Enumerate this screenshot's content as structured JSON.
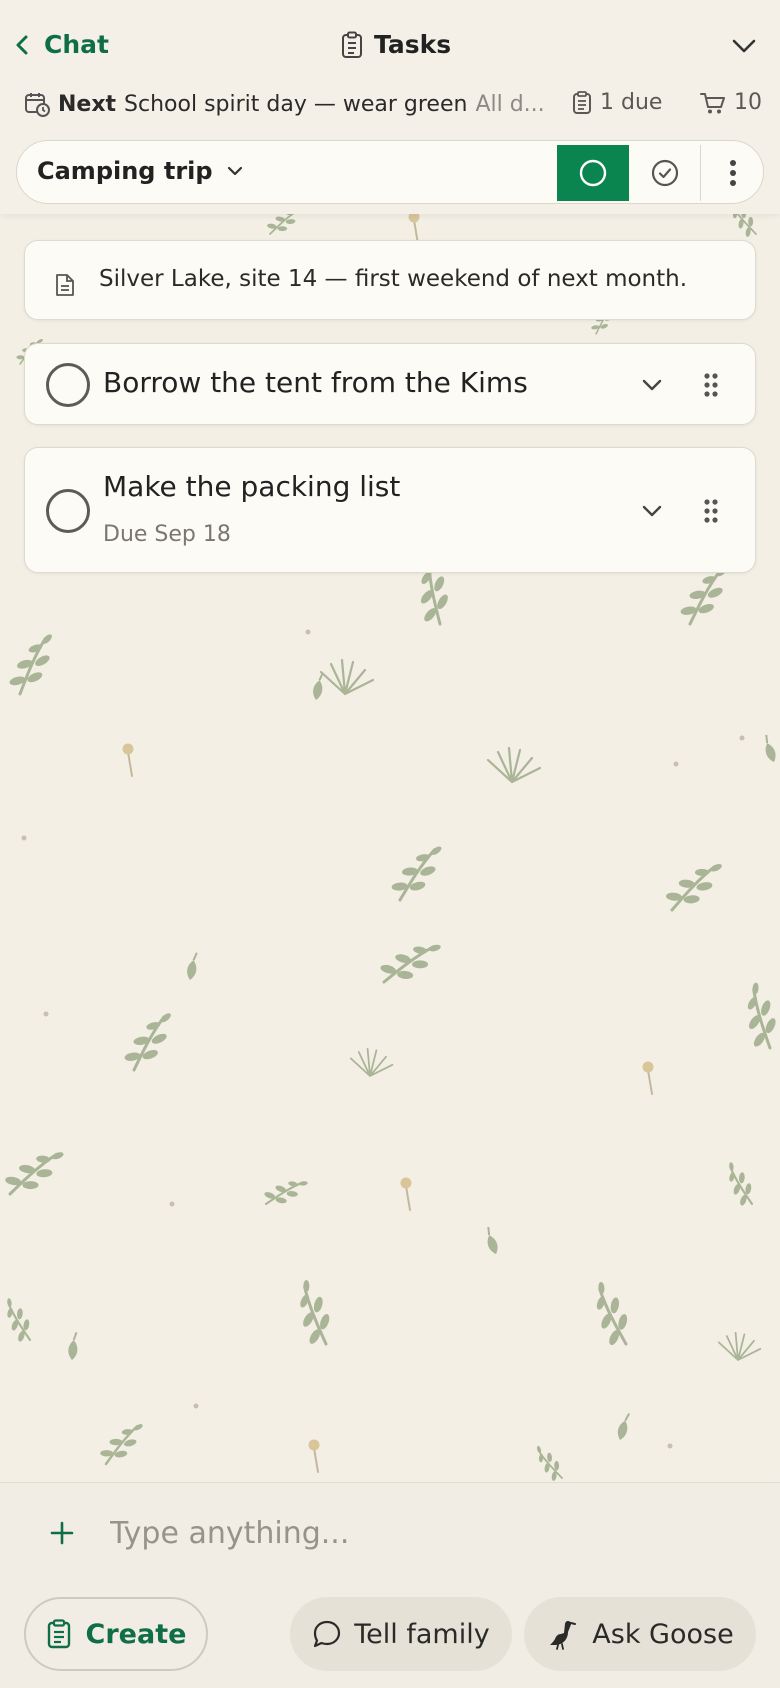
{
  "header": {
    "back_label": "Chat",
    "title": "Tasks",
    "next_label": "Next",
    "next_event": "School spirit day — wear green",
    "next_event_rest": "All d...",
    "due_count": "1 due",
    "cart_count": "10"
  },
  "list": {
    "name": "Camping trip",
    "filter_selected": "open"
  },
  "note": {
    "text": "Silver Lake, site 14 — first weekend of next month."
  },
  "tasks": [
    {
      "title": "Borrow the tent from the Kims",
      "due": ""
    },
    {
      "title": "Make the packing list",
      "due": "Due Sep 18"
    }
  ],
  "composer": {
    "placeholder": "Type anything...",
    "create_label": "Create",
    "tell_family_label": "Tell family",
    "ask_goose_label": "Ask Goose"
  },
  "colors": {
    "accent": "#0f6e46",
    "accent_fill": "#0b8550",
    "background": "#f3efe5",
    "card": "#fdfbf6"
  }
}
